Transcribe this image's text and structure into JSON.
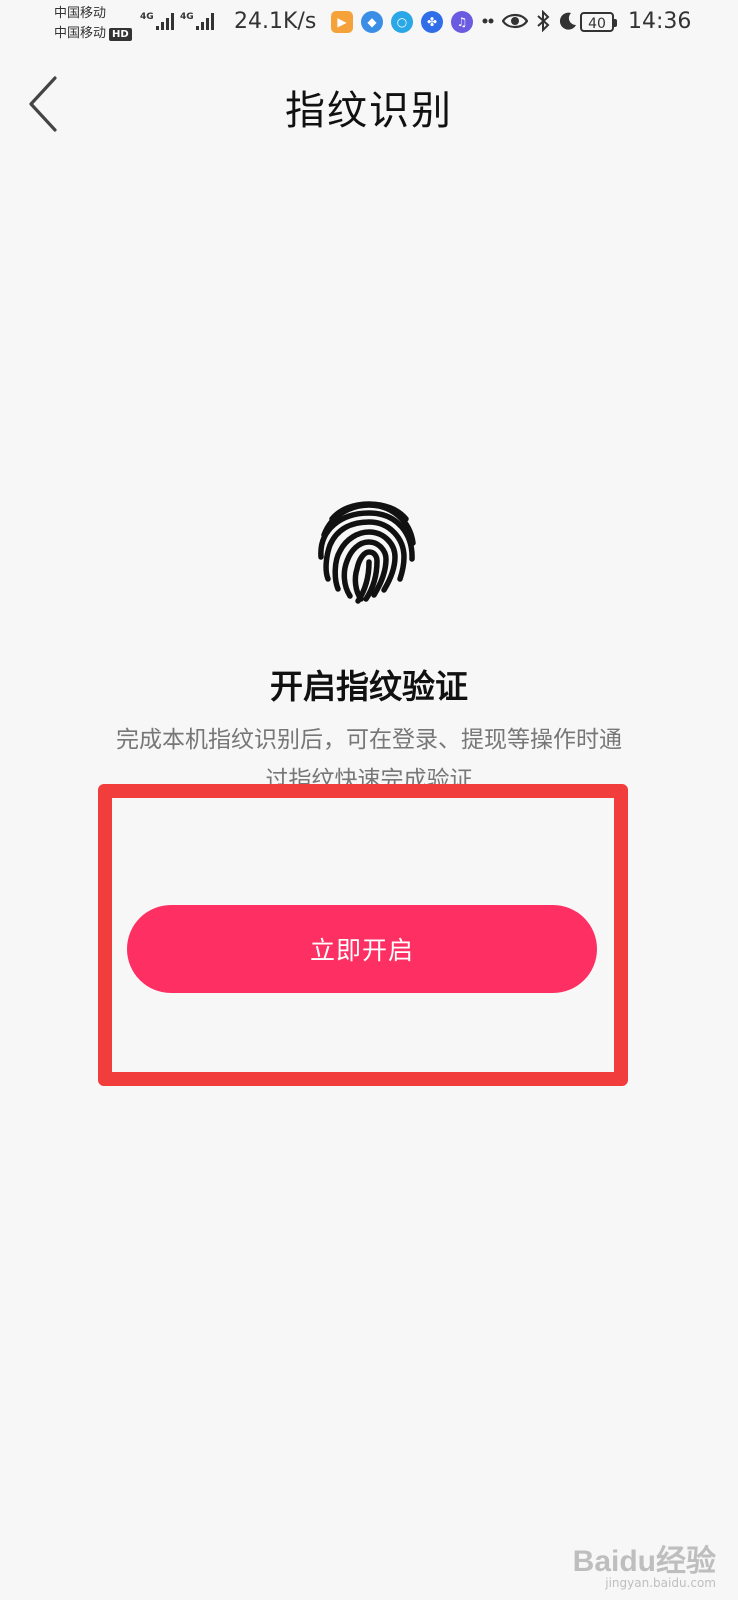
{
  "status_bar": {
    "carrier_1": "中国移动",
    "carrier_2": "中国移动",
    "hd_label": "HD",
    "network_1": "4G",
    "network_2": "4G",
    "net_speed": "24.1K/s",
    "battery": "40",
    "time": "14:36",
    "icons": [
      "video-app-icon",
      "browser-app-icon",
      "search-app-icon",
      "baidu-app-icon",
      "music-app-icon",
      "more-dots-icon",
      "eye-icon",
      "bluetooth-icon",
      "moon-icon"
    ]
  },
  "header": {
    "title": "指纹识别",
    "back_icon": "chevron-left-icon"
  },
  "content": {
    "icon": "fingerprint-icon",
    "headline": "开启指纹验证",
    "description_line_1": "完成本机指纹识别后，可在登录、提现等操作时通",
    "description_line_2": "过指纹快速完成验证",
    "button_label": "立即开启"
  },
  "colors": {
    "accent": "#fe2f63",
    "highlight_box": "#f23d3d",
    "background": "#f7f7f7"
  },
  "watermark": {
    "logo": "Baidu经验",
    "url": "jingyan.baidu.com"
  }
}
